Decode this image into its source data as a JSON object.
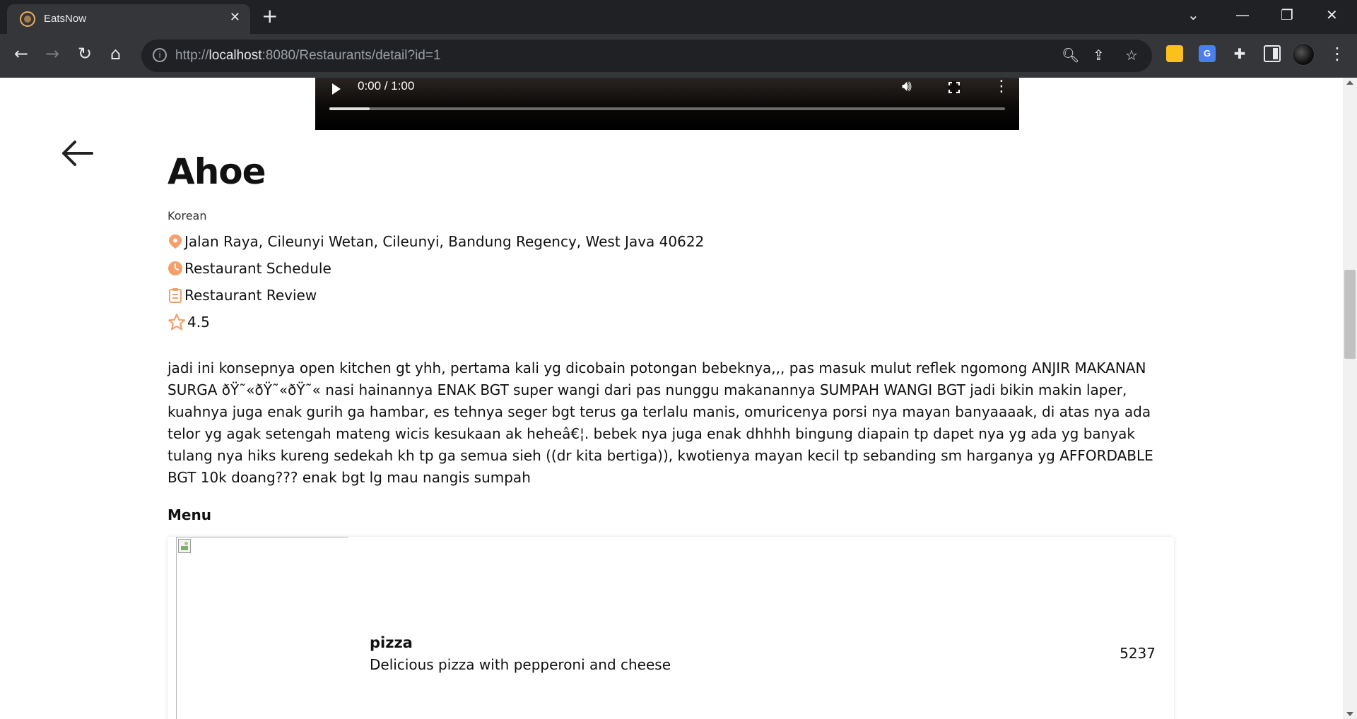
{
  "browser": {
    "tab_title": "EatsNow",
    "url_scheme": "http://",
    "url_host": "localhost",
    "url_path": ":8080/Restaurants/detail?id=1"
  },
  "video": {
    "time": "0:00 / 1:00",
    "progress_fraction": 0.06
  },
  "restaurant": {
    "name": "Ahoe",
    "category": "Korean",
    "address": "Jalan Raya, Cileunyi Wetan, Cileunyi, Bandung Regency, West Java 40622",
    "schedule_label": "Restaurant Schedule",
    "review_label": "Restaurant Review",
    "rating": "4.5",
    "review_text": "jadi ini konsepnya open kitchen gt yhh, pertama kali yg dicobain potongan bebeknya,,, pas masuk mulut reflek ngomong ANJIR MAKANAN SURGA ðŸ˜«ðŸ˜«ðŸ˜« nasi hainannya ENAK BGT super wangi dari pas nunggu makanannya SUMPAH WANGI BGT jadi bikin makin laper, kuahnya juga enak gurih ga hambar, es tehnya seger bgt terus ga terlalu manis, omuricenya porsi nya mayan banyaaaak, di atas nya ada telor yg agak setengah mateng wicis kesukaan ak heheâ€¦. bebek nya juga enak dhhhh bingung diapain tp dapet nya yg ada yg banyak tulang nya hiks kureng sedekah kh tp ga semua sieh ((dr kita bertiga)), kwotienya mayan kecil tp sebanding sm harganya yg AFFORDABLE BGT 10k doang??? enak bgt lg mau nangis sumpah"
  },
  "menu": {
    "heading": "Menu",
    "items": [
      {
        "name": "pizza",
        "description": "Delicious pizza with pepperoni and cheese",
        "price": "5237"
      }
    ]
  },
  "colors": {
    "accent": "#f5a06b",
    "chrome_dark": "#202124",
    "chrome_toolbar": "#35363a"
  }
}
